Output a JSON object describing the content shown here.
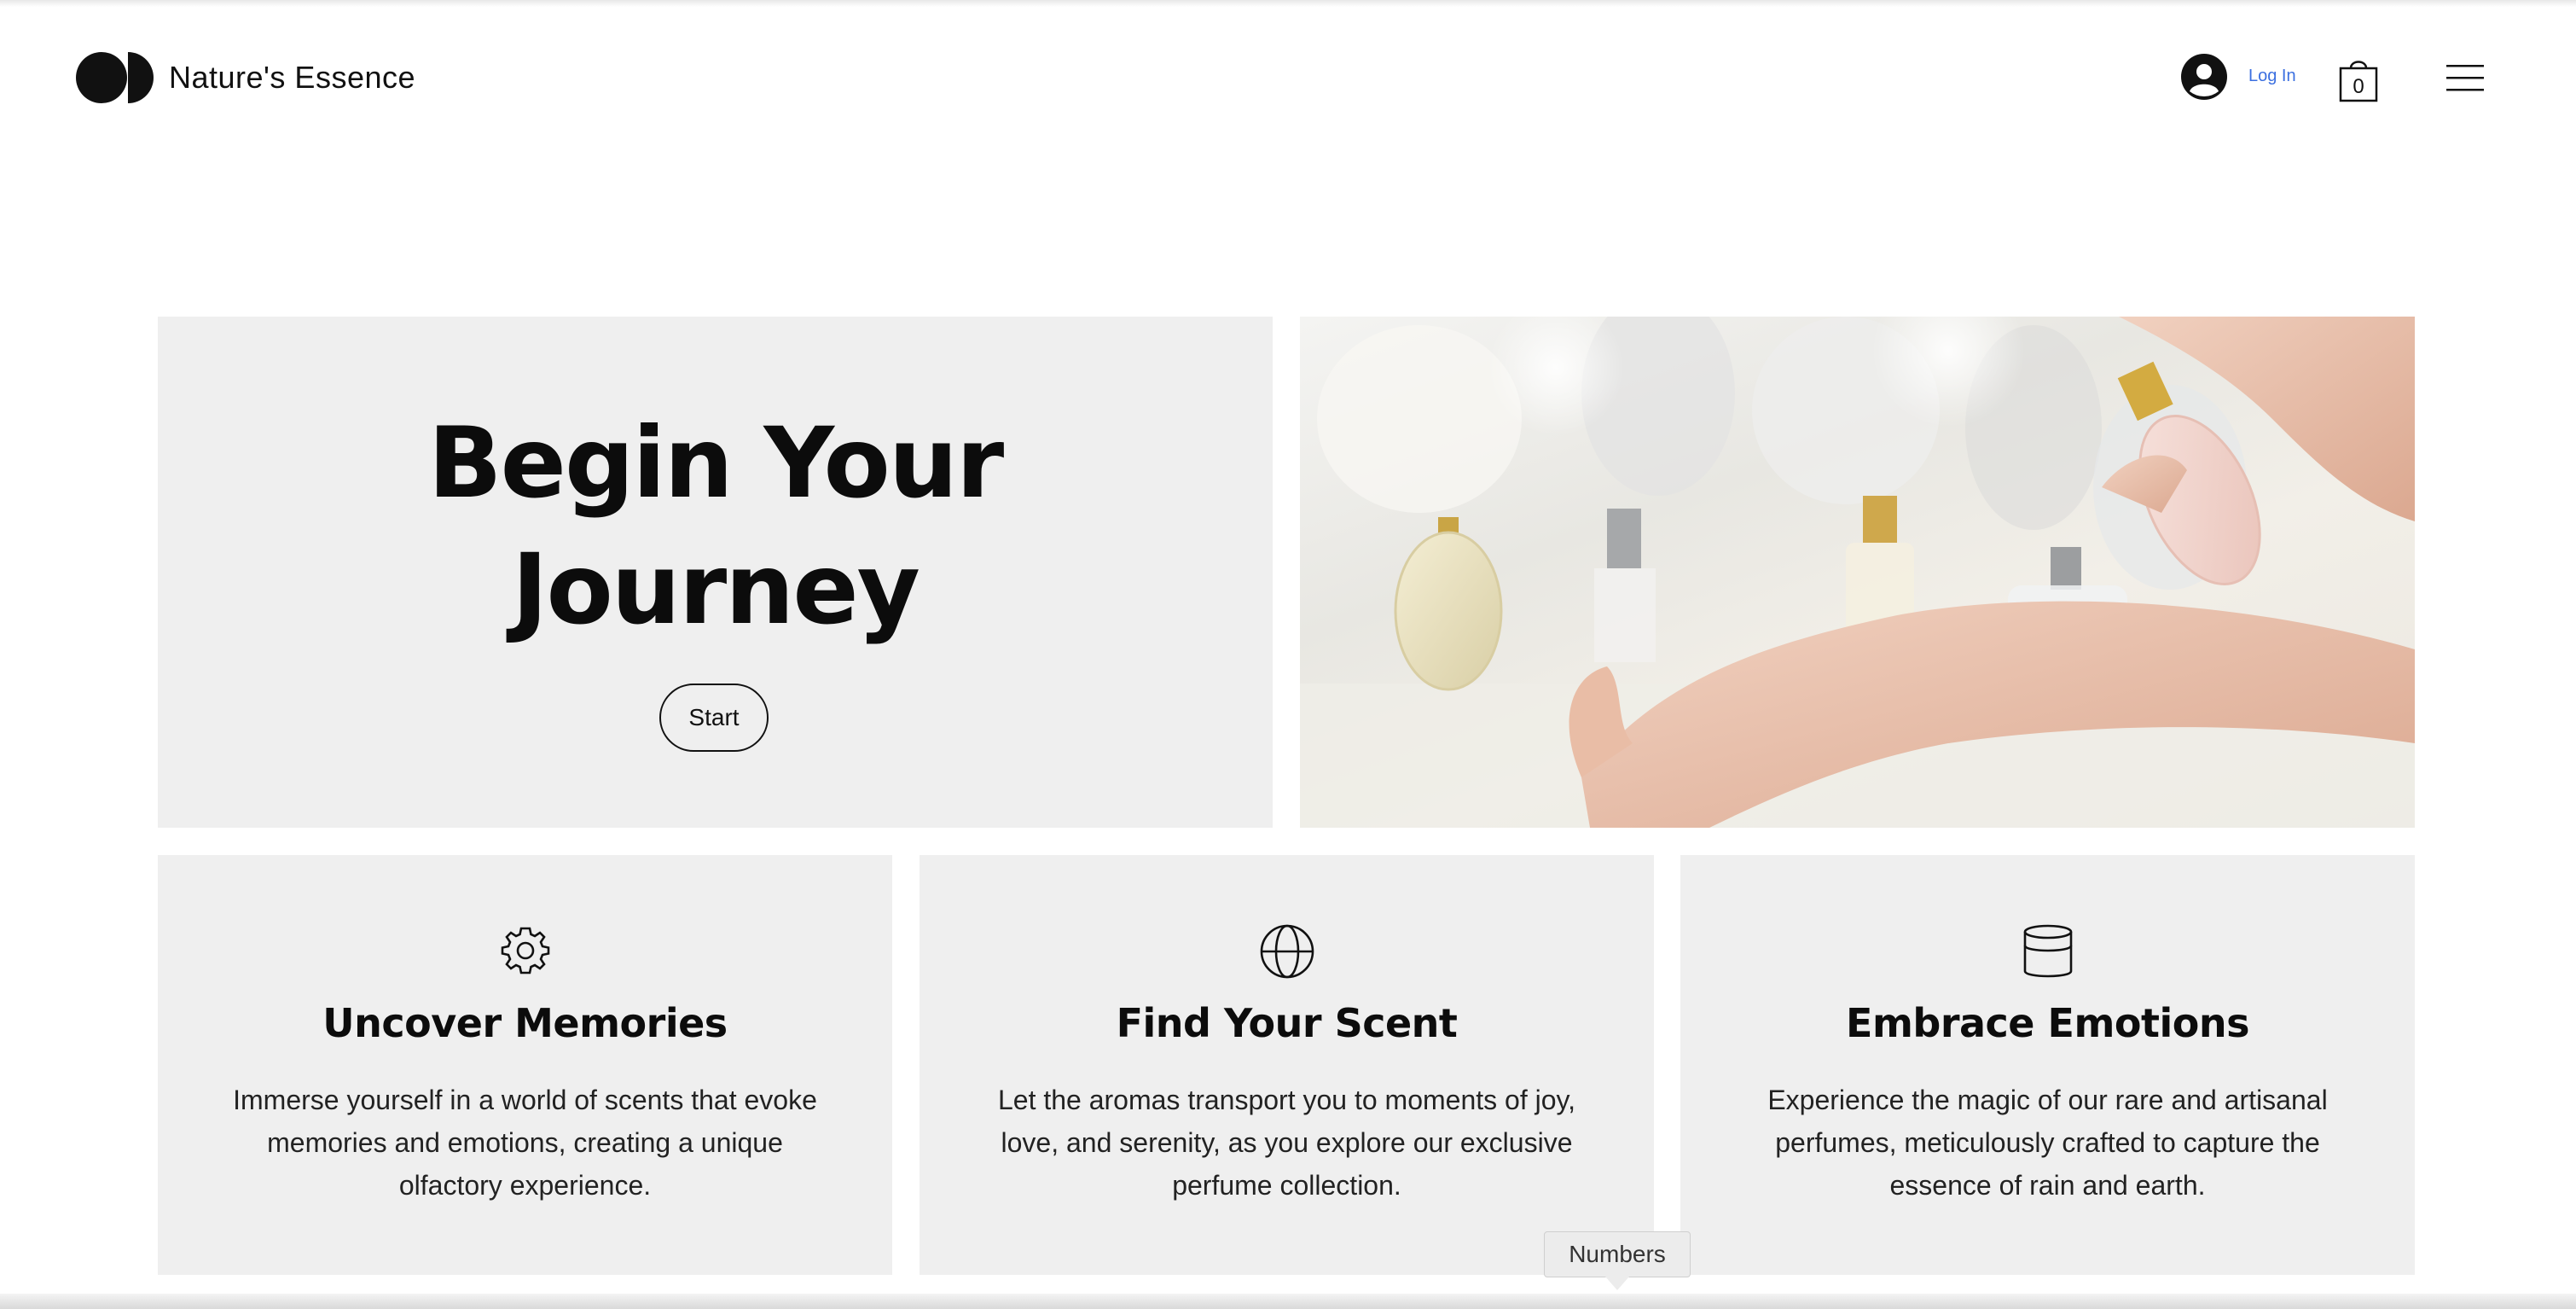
{
  "header": {
    "brand": "Nature's Essence",
    "login_label": "Log In",
    "cart_count": "0"
  },
  "hero": {
    "title_line1": "Begin Your",
    "title_line2": "Journey",
    "start_label": "Start",
    "image_alt": "Perfume being sprayed on wrist"
  },
  "cards": [
    {
      "icon": "gear-icon",
      "title": "Uncover Memories",
      "text": "Immerse yourself in a world of scents that evoke memories and emotions, creating a unique olfactory experience."
    },
    {
      "icon": "globe-icon",
      "title": "Find Your Scent",
      "text": "Let the aromas transport you to moments of joy, love, and serenity, as you explore our exclusive perfume collection."
    },
    {
      "icon": "database-icon",
      "title": "Embrace Emotions",
      "text": "Experience the magic of our rare and artisanal perfumes, meticulously crafted to capture the essence of rain and earth."
    }
  ],
  "tooltip": {
    "label": "Numbers"
  },
  "colors": {
    "accent_link": "#3b6fe0",
    "panel_bg": "#efefef",
    "text": "#0c0c0c"
  }
}
